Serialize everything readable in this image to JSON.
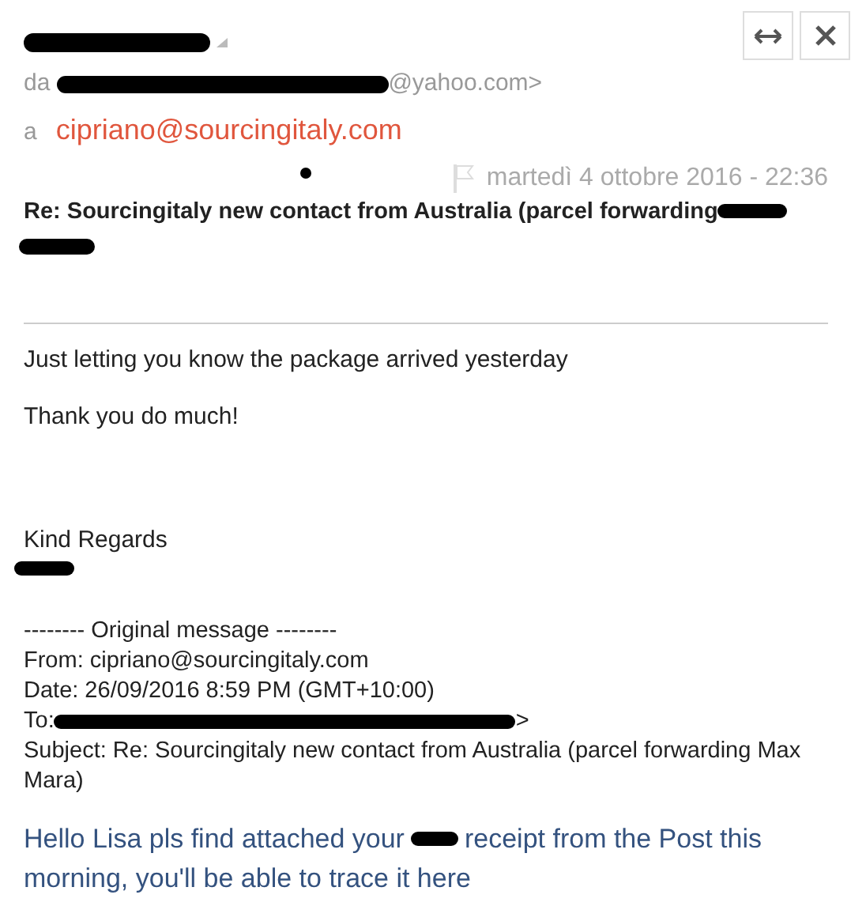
{
  "header": {
    "from_prefix": "da",
    "from_visible": "@yahoo.com>",
    "to_prefix": "a",
    "to": "cipriano@sourcingitaly.com",
    "date": "martedì 4 ottobre 2016 - 22:36",
    "subject": "Re: Sourcingitaly new contact from Australia (parcel forwarding"
  },
  "body": [
    "Just letting you know the package arrived yesterday",
    "Thank you do much!",
    "Kind Regards"
  ],
  "original": {
    "heading": "-------- Original message --------",
    "from": "From: cipriano@sourcingitaly.com",
    "date": "Date: 26/09/2016 8:59 PM (GMT+10:00)",
    "to_label": "To:",
    "to_end": ">",
    "subject": "Subject: Re: Sourcingitaly new contact from Australia (parcel forwarding Max Mara)"
  },
  "quoted_body": {
    "before": "Hello Lisa pls find attached your",
    "after": "receipt from the Post this",
    "line_2": "morning, you'll be able to trace it here"
  }
}
